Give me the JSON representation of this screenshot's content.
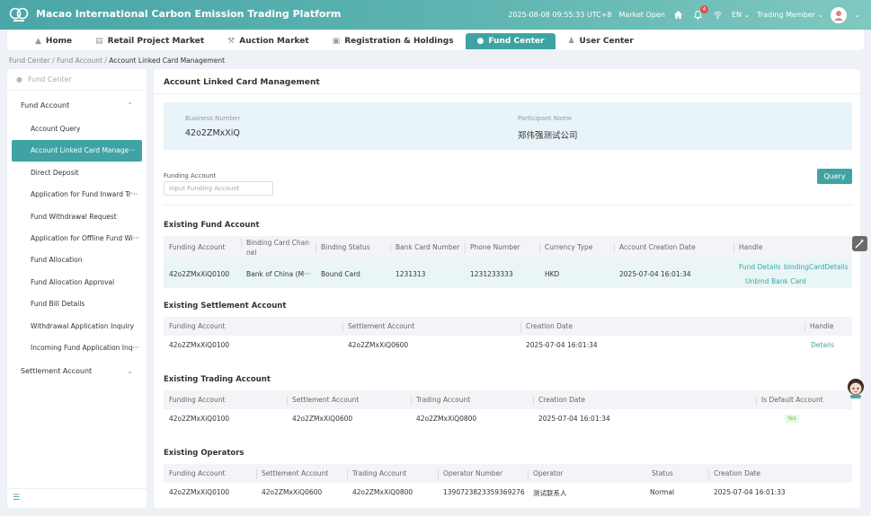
{
  "header": {
    "title": "Macao International Carbon Emission Trading Platform",
    "datetime": "2025-08-08 09:55:33 UTC+8",
    "market_status": "Market Open",
    "notification_count": "4",
    "language": "EN",
    "role": "Trading Member"
  },
  "nav": {
    "tabs": [
      {
        "label": "Home",
        "icon": "home-icon"
      },
      {
        "label": "Retail Project Market",
        "icon": "store-icon"
      },
      {
        "label": "Auction Market",
        "icon": "gavel-icon"
      },
      {
        "label": "Registration & Holdings",
        "icon": "document-icon"
      },
      {
        "label": "Fund Center",
        "icon": "fund-icon",
        "active": true
      },
      {
        "label": "User Center",
        "icon": "user-icon"
      }
    ]
  },
  "breadcrumb": [
    "Fund Center",
    "Fund Account",
    "Account Linked Card Management"
  ],
  "sidebar": {
    "header": "Fund Center",
    "group1": "Fund Account",
    "items": [
      "Account Query",
      "Account Linked Card Manage···",
      "Direct Deposit",
      "Application for Fund Inward Tr···",
      "Fund Withdrawal Request",
      "Application for Offline Fund Wi···",
      "Fund Allocation",
      "Fund Allocation Approval",
      "Fund Bill Details",
      "Withdrawal Application Inquiry",
      "Incoming Fund Application Inq···"
    ],
    "group2": "Settlement Account"
  },
  "main": {
    "title": "Account Linked Card Management",
    "business_number_label": "Business Number",
    "business_number": "42o2ZMxXiQ",
    "participant_name_label": "Participant Name",
    "participant_name": "郑伟强测试公司",
    "funding_account_label": "Funding Account",
    "funding_account_placeholder": "input Funding Account",
    "query_button": "Query"
  },
  "fund_account": {
    "title": "Existing Fund Account",
    "headers": [
      "Funding Account",
      "Binding Card Chan nel",
      "Binding Status",
      "Bank Card Number",
      "Phone Number",
      "Currency Type",
      "Account Creation Date",
      "Handle"
    ],
    "row": [
      "42o2ZMxXiQ0100",
      "Bank of China (M···",
      "Bound Card",
      "1231313",
      "1231233333",
      "HKD",
      "2025-07-04 16:01:34"
    ],
    "actions": [
      "Fund Details",
      "bindingCardDetails",
      "Unbind Bank Card"
    ]
  },
  "settlement_account": {
    "title": "Existing Settlement Account",
    "headers": [
      "Funding Account",
      "Settlement Account",
      "Creation Date",
      "Handle"
    ],
    "row": [
      "42o2ZMxXiQ0100",
      "42o2ZMxXiQ0600",
      "2025-07-04 16:01:34"
    ],
    "action": "Details"
  },
  "trading_account": {
    "title": "Existing Trading Account",
    "headers": [
      "Funding Account",
      "Settlement Account",
      "Trading Account",
      "Creation Date",
      "Is Default Account"
    ],
    "row": [
      "42o2ZMxXiQ0100",
      "42o2ZMxXiQ0600",
      "42o2ZMxXiQ0800",
      "2025-07-04 16:01:34",
      "Yes"
    ]
  },
  "operators": {
    "title": "Existing Operators",
    "headers": [
      "Funding Account",
      "Settlement Account",
      "Trading Account",
      "Operator Number",
      "Operator",
      "Status",
      "Creation Date"
    ],
    "row": [
      "42o2ZMxXiQ0100",
      "42o2ZMxXiQ0600",
      "42o2ZMxXiQ0800",
      "1390723823359369276",
      "测试联系人",
      "Normal",
      "2025-07-04 16:01:33"
    ]
  },
  "colors": {
    "accent": "#3fa3a3",
    "header_gradient_start": "#4aa6a8",
    "info_bg": "#e8f4f8"
  }
}
